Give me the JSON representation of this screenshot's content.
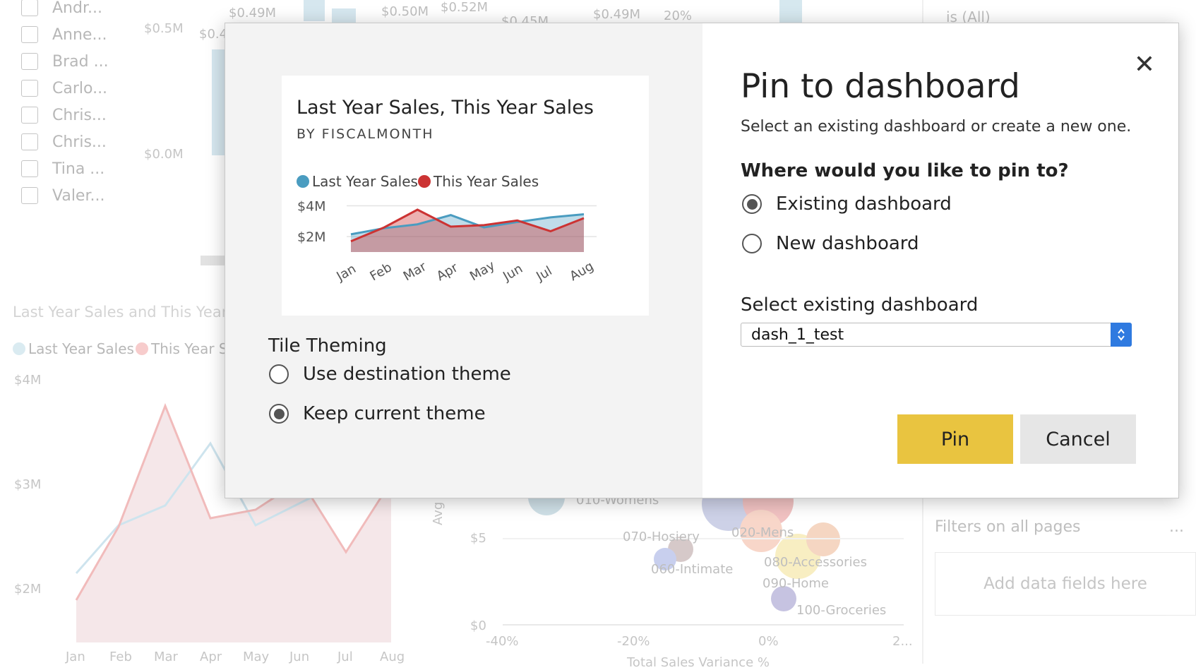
{
  "background": {
    "slicer": [
      "Andr...",
      "Anne...",
      "Brad ...",
      "Carlo...",
      "Chris...",
      "Chris...",
      "Tina ...",
      "Valer..."
    ],
    "top_chart": {
      "y_ticks": [
        "$0.5M",
        "$0.0M"
      ],
      "data_labels": [
        "$0.49M",
        "$0.4",
        "$0.50M",
        "$0.52M",
        "$0.45M",
        "$0.49M",
        "20%"
      ]
    },
    "area_chart": {
      "title": "Last Year Sales and This Year",
      "legend": [
        "Last Year Sales",
        "This Year S"
      ],
      "y_ticks": [
        "$4M",
        "$3M",
        "$2M"
      ],
      "x_ticks": [
        "Jan",
        "Feb",
        "Mar",
        "Apr",
        "May",
        "Jun",
        "Jul",
        "Aug"
      ]
    },
    "scatter": {
      "y_label": "Avg $/U",
      "y_ticks": [
        "$5",
        "$0"
      ],
      "x_ticks": [
        "-40%",
        "-20%",
        "0%",
        "2..."
      ],
      "x_label": "Total Sales Variance %",
      "labels": [
        "070-Hosiery",
        "060-Intimate",
        "020-Mens",
        "080-Accessories",
        "090-Home",
        "100-Groceries",
        "010-Womens"
      ]
    },
    "filter_pane": {
      "top_text": "is (All)",
      "filters_on_all_pages": "Filters on all pages",
      "more": "...",
      "add_data_fields": "Add data fields here"
    }
  },
  "dialog": {
    "title": "Pin to dashboard",
    "subtitle": "Select an existing dashboard or create a new one.",
    "question": "Where would you like to pin to?",
    "pin_options": [
      {
        "label": "Existing dashboard",
        "selected": true
      },
      {
        "label": "New dashboard",
        "selected": false
      }
    ],
    "select_label": "Select existing dashboard",
    "select_value": "dash_1_test",
    "close_icon": "close-icon",
    "pin_button": "Pin",
    "cancel_button": "Cancel",
    "tile_theming": {
      "title": "Tile Theming",
      "options": [
        {
          "label": "Use destination theme",
          "selected": false
        },
        {
          "label": "Keep current theme",
          "selected": true
        }
      ]
    },
    "colors": {
      "pin": "#e9c440",
      "cancel": "#e6e6e6",
      "select_arrow": "#2f7ae0"
    }
  },
  "chart_data": {
    "type": "area",
    "title": "Last Year Sales, This Year Sales",
    "subtitle": "BY FISCALMONTH",
    "categories": [
      "Jan",
      "Feb",
      "Mar",
      "Apr",
      "May",
      "Jun",
      "Jul",
      "Aug"
    ],
    "y_ticks": [
      "$4M",
      "$2M"
    ],
    "ylim": [
      1,
      4.3
    ],
    "grid": true,
    "legend_position": "top-left",
    "series": [
      {
        "name": "Last Year Sales",
        "color": "#4a9cc0",
        "values": [
          2.15,
          2.55,
          2.8,
          3.4,
          2.6,
          2.95,
          3.25,
          3.45
        ]
      },
      {
        "name": "This Year Sales",
        "color": "#cc3333",
        "values": [
          1.7,
          2.6,
          3.75,
          2.65,
          2.75,
          3.05,
          2.35,
          3.2
        ]
      }
    ]
  }
}
